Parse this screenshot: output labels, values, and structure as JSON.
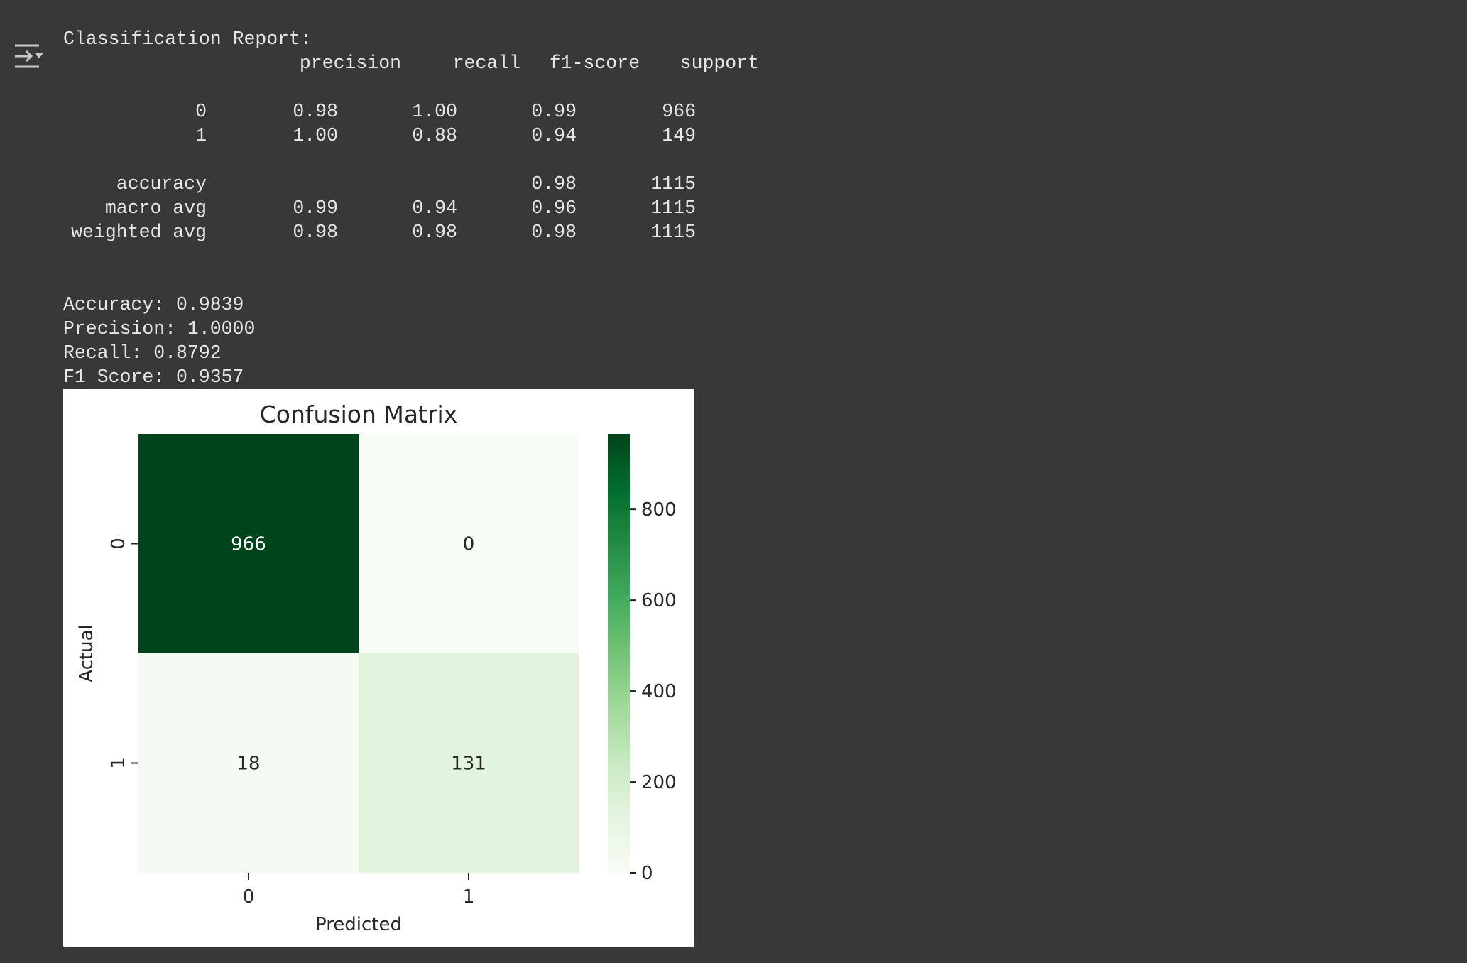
{
  "report": {
    "title": "Classification Report:",
    "headers": [
      "precision",
      "recall",
      "f1-score",
      "support"
    ],
    "class_rows": [
      {
        "label": "0",
        "precision": "0.98",
        "recall": "1.00",
        "f1": "0.99",
        "support": "966"
      },
      {
        "label": "1",
        "precision": "1.00",
        "recall": "0.88",
        "f1": "0.94",
        "support": "149"
      }
    ],
    "summary_rows": [
      {
        "label": "accuracy",
        "precision": "",
        "recall": "",
        "f1": "0.98",
        "support": "1115"
      },
      {
        "label": "macro avg",
        "precision": "0.99",
        "recall": "0.94",
        "f1": "0.96",
        "support": "1115"
      },
      {
        "label": "weighted avg",
        "precision": "0.98",
        "recall": "0.98",
        "f1": "0.98",
        "support": "1115"
      }
    ]
  },
  "metrics": {
    "accuracy": "Accuracy: 0.9839",
    "precision": "Precision: 1.0000",
    "recall": "Recall: 0.8792",
    "f1": "F1 Score: 0.9357"
  },
  "icons": {
    "output_toggle": "output-collapse-icon"
  },
  "colors": {
    "background": "#383838",
    "text": "#e6e6e6",
    "cmap_low": "#f7fcf5",
    "cmap_high": "#00441b"
  },
  "chart_data": {
    "type": "heatmap",
    "title": "Confusion Matrix",
    "xlabel": "Predicted",
    "ylabel": "Actual",
    "x_categories": [
      "0",
      "1"
    ],
    "y_categories": [
      "0",
      "1"
    ],
    "values": [
      [
        966,
        0
      ],
      [
        18,
        131
      ]
    ],
    "colorbar": {
      "min": 0,
      "max": 966,
      "ticks": [
        0,
        200,
        400,
        600,
        800
      ]
    },
    "colormap": "Greens"
  }
}
